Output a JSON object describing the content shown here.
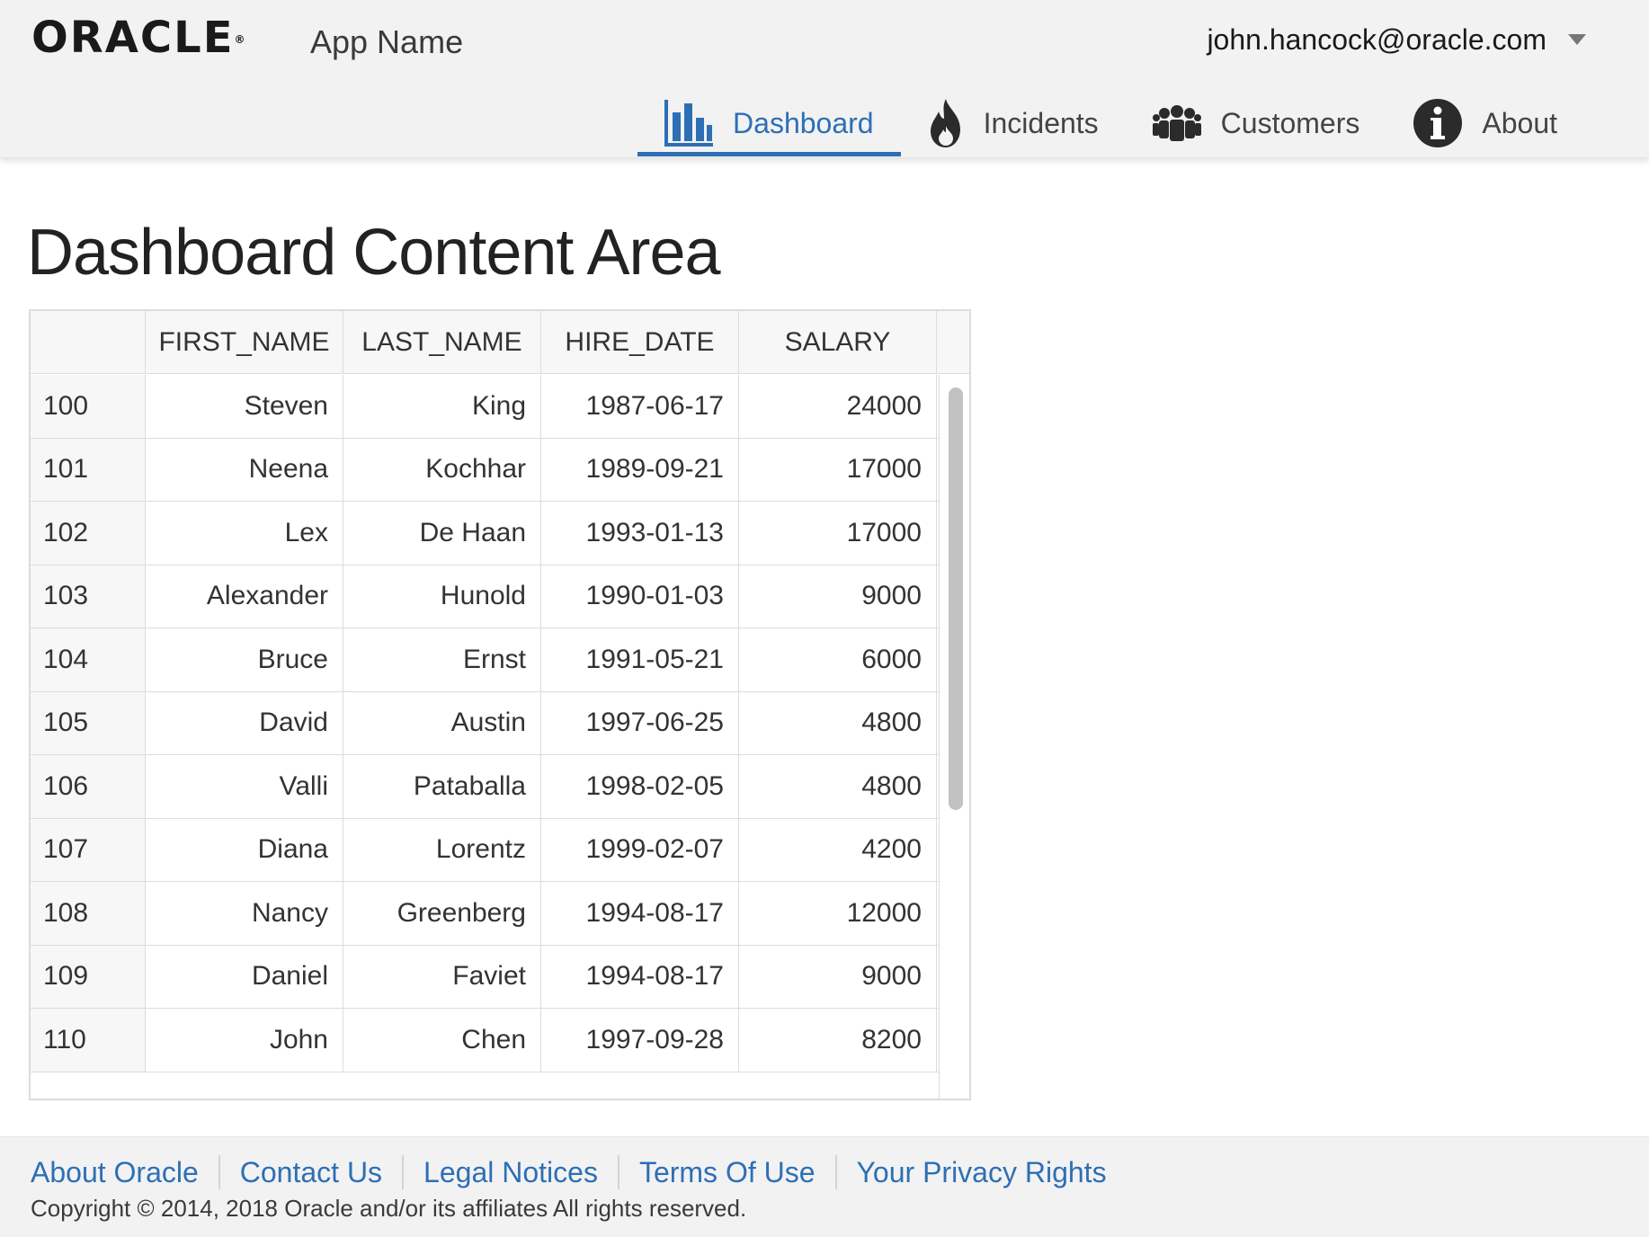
{
  "header": {
    "logo_text": "ORACLE",
    "logo_mark": "®",
    "app_name": "App Name",
    "user_email": "john.hancock@oracle.com"
  },
  "nav": {
    "items": [
      {
        "label": "Dashboard",
        "icon": "bar-chart-icon",
        "active": true
      },
      {
        "label": "Incidents",
        "icon": "flame-icon",
        "active": false
      },
      {
        "label": "Customers",
        "icon": "people-icon",
        "active": false
      },
      {
        "label": "About",
        "icon": "info-icon",
        "active": false
      }
    ]
  },
  "main": {
    "title": "Dashboard Content Area",
    "table": {
      "columns": [
        "",
        "FIRST_NAME",
        "LAST_NAME",
        "HIRE_DATE",
        "SALARY"
      ],
      "rows": [
        [
          "100",
          "Steven",
          "King",
          "1987-06-17",
          "24000"
        ],
        [
          "101",
          "Neena",
          "Kochhar",
          "1989-09-21",
          "17000"
        ],
        [
          "102",
          "Lex",
          "De Haan",
          "1993-01-13",
          "17000"
        ],
        [
          "103",
          "Alexander",
          "Hunold",
          "1990-01-03",
          "9000"
        ],
        [
          "104",
          "Bruce",
          "Ernst",
          "1991-05-21",
          "6000"
        ],
        [
          "105",
          "David",
          "Austin",
          "1997-06-25",
          "4800"
        ],
        [
          "106",
          "Valli",
          "Pataballa",
          "1998-02-05",
          "4800"
        ],
        [
          "107",
          "Diana",
          "Lorentz",
          "1999-02-07",
          "4200"
        ],
        [
          "108",
          "Nancy",
          "Greenberg",
          "1994-08-17",
          "12000"
        ],
        [
          "109",
          "Daniel",
          "Faviet",
          "1994-08-17",
          "9000"
        ],
        [
          "110",
          "John",
          "Chen",
          "1997-09-28",
          "8200"
        ]
      ]
    }
  },
  "footer": {
    "links": [
      "About Oracle",
      "Contact Us",
      "Legal Notices",
      "Terms Of Use",
      "Your Privacy Rights"
    ],
    "copyright": "Copyright © 2014, 2018 Oracle and/or its affiliates All rights reserved."
  },
  "colors": {
    "accent": "#2d6fb5",
    "header_bg": "#f2f2f2",
    "border": "#dcdcdc"
  }
}
